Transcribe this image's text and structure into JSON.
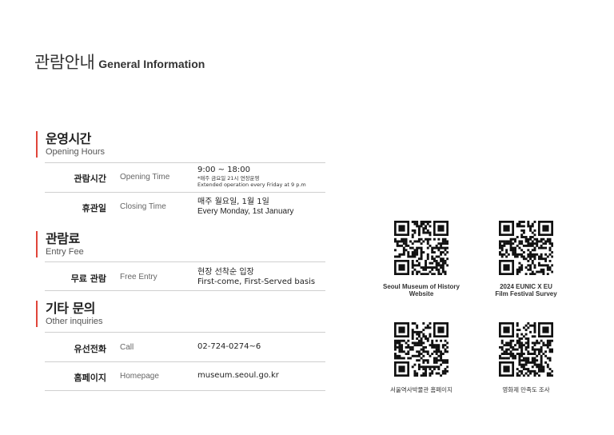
{
  "title": {
    "ko": "관람안내",
    "en": "General Information"
  },
  "sections": [
    {
      "ko": "운영시간",
      "en": "Opening Hours",
      "rows": [
        {
          "ko": "관람시간",
          "en": "Opening Time",
          "value": "9:00 ~ 18:00",
          "note": "*매주 금요일 21시 연장운영",
          "note2": "Extended operation every Friday at 9 p.m"
        },
        {
          "ko": "휴관일",
          "en": "Closing Time",
          "value": "매주 월요일, 1월 1일",
          "value2": "Every Monday, 1st January"
        }
      ]
    },
    {
      "ko": "관람료",
      "en": "Entry Fee",
      "rows": [
        {
          "ko": "무료 관람",
          "en": "Free Entry",
          "value": "현장 선착순 입장",
          "value2": "First-come, First-Served basis"
        }
      ]
    },
    {
      "ko": "기타 문의",
      "en": "Other inquiries",
      "rows": [
        {
          "ko": "유선전화",
          "en": "Call",
          "value": "02-724-0274~6"
        },
        {
          "ko": "홈페이지",
          "en": "Homepage",
          "value": "museum.seoul.go.kr"
        }
      ]
    }
  ],
  "qrcodes": [
    {
      "label1": "Seoul Museum of History",
      "label2": "Website",
      "icon": "qr-code-icon"
    },
    {
      "label1": "2024 EUNIC X EU",
      "label2": "Film Festival Survey",
      "icon": "qr-code-icon"
    },
    {
      "label1": "서울역사박물관 홈페이지",
      "icon": "qr-code-icon"
    },
    {
      "label1": "영화제 만족도 조사",
      "icon": "qr-code-icon"
    }
  ],
  "colors": {
    "accent": "#e0453a",
    "divider": "#cfcfcf",
    "text": "#222222"
  }
}
